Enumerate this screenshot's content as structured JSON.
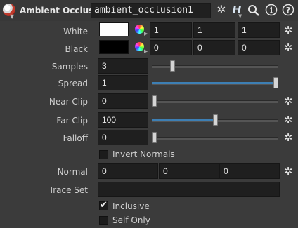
{
  "header": {
    "node_type": "Ambient Occlusion",
    "node_name": "ambient_occlusion1",
    "icons": [
      "gear-icon",
      "hscript-icon",
      "search-icon",
      "info-icon",
      "help-icon"
    ]
  },
  "white": {
    "label": "White",
    "color": "#ffffff",
    "values": [
      "1",
      "1",
      "1"
    ]
  },
  "black": {
    "label": "Black",
    "color": "#000000",
    "values": [
      "0",
      "0",
      "0"
    ]
  },
  "samples": {
    "label": "Samples",
    "value": "3",
    "slider_fraction": 0.15
  },
  "spread": {
    "label": "Spread",
    "value": "1",
    "slider_fraction": 1.0
  },
  "near_clip": {
    "label": "Near Clip",
    "value": "0",
    "slider_fraction": 0.0
  },
  "far_clip": {
    "label": "Far Clip",
    "value": "100",
    "slider_fraction": 0.5
  },
  "falloff": {
    "label": "Falloff",
    "value": "0",
    "slider_fraction": 0.0
  },
  "invert_normals": {
    "label": "Invert Normals",
    "checked": false
  },
  "normal": {
    "label": "Normal",
    "values": [
      "0",
      "0",
      "0"
    ]
  },
  "trace_set": {
    "label": "Trace Set",
    "value": ""
  },
  "inclusive": {
    "label": "Inclusive",
    "checked": true
  },
  "self_only": {
    "label": "Self Only",
    "checked": false
  },
  "colors": {
    "accent": "#3d7fb4",
    "background": "#3b3b3b",
    "field": "#1f1f1f"
  }
}
